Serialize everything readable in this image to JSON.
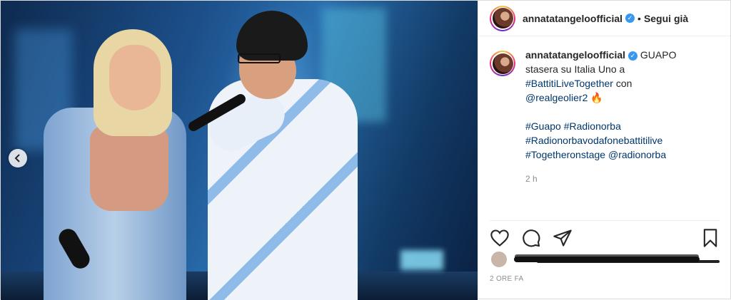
{
  "post": {
    "author": {
      "username": "annatatangeloofficial",
      "verified": true,
      "follow_label": "Segui già"
    },
    "caption": {
      "line1": "GUAPO",
      "line2": "stasera su Italia Uno a",
      "tag_event": "#BattitiLiveTogether",
      "word_con": "con",
      "mention": "@realgeolier2",
      "emoji": "🔥",
      "hashtags": [
        "#Guapo #Radionorba",
        "#Radionorbavodafonebattitilive",
        "#Togetheronstage @radionorba"
      ]
    },
    "relative_time": "2 h",
    "date_label": "2 ORE FA"
  },
  "colors": {
    "verified": "#3897f0",
    "link": "#00376b",
    "muted": "#8e8e8e"
  },
  "icons": {
    "like": "heart-icon",
    "comment": "comment-icon",
    "share": "paper-plane-icon",
    "save": "bookmark-icon",
    "carousel_prev": "chevron-left-icon"
  }
}
